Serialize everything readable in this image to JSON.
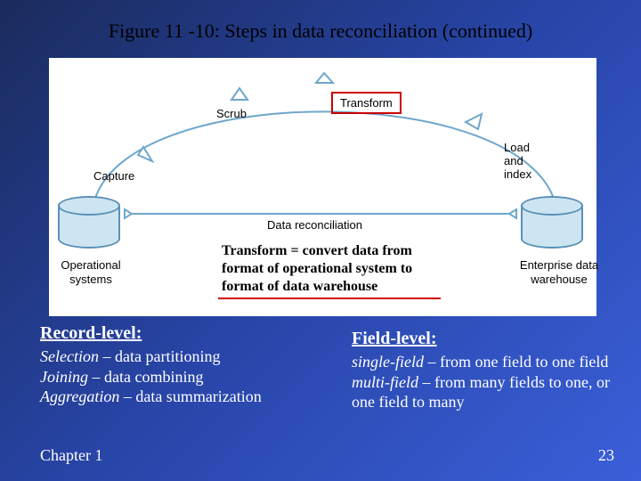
{
  "title": "Figure 11 -10: Steps in data reconciliation (continued)",
  "diagram": {
    "left_cylinder": "Operational\nsystems",
    "right_cylinder": "Enterprise\ndata\nwarehouse",
    "steps": {
      "capture": "Capture",
      "scrub": "Scrub",
      "transform": "Transform",
      "load": "Load\nand\nindex"
    },
    "reconciliation": "Data reconciliation"
  },
  "caption": "Transform = convert data from format of operational system to format of data warehouse",
  "columns": {
    "left": {
      "header": "Record-level:",
      "l1a": "Selection",
      "l1b": " – data partitioning",
      "l2a": "Joining",
      "l2b": " – data combining",
      "l3a": "Aggregation",
      "l3b": " – data summarization"
    },
    "right": {
      "header": "Field-level:",
      "l1a": "single-field",
      "l1b": " – from one field to one field",
      "l2a": "multi-field",
      "l2b": " – from many fields to one, or one field to many"
    }
  },
  "footer": {
    "left": "Chapter 1",
    "right": "23"
  }
}
